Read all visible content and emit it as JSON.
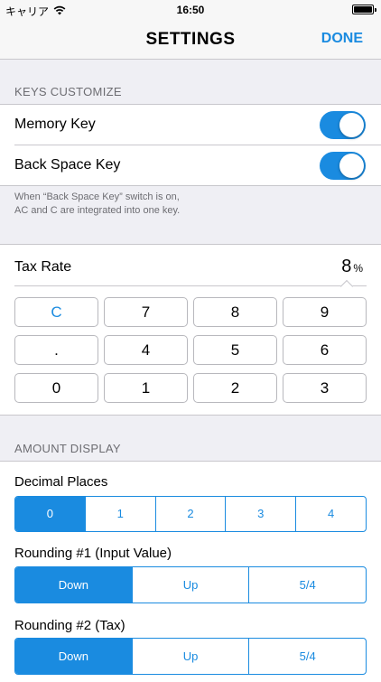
{
  "status_bar": {
    "carrier": "キャリア",
    "time": "16:50"
  },
  "nav": {
    "title": "SETTINGS",
    "done_label": "DONE"
  },
  "keys_customize": {
    "header": "KEYS CUSTOMIZE",
    "memory_key": {
      "label": "Memory Key",
      "on": true
    },
    "back_space_key": {
      "label": "Back Space Key",
      "on": true
    },
    "footnote_line1": "When “Back Space Key” switch is on,",
    "footnote_line2": "AC and C are integrated into one key."
  },
  "tax": {
    "label": "Tax Rate",
    "value": "8",
    "unit": "%",
    "keys": [
      [
        "C",
        "7",
        "8",
        "9"
      ],
      [
        ".",
        "4",
        "5",
        "6"
      ],
      [
        "0",
        "1",
        "2",
        "3"
      ]
    ]
  },
  "amount_display": {
    "header": "AMOUNT DISPLAY",
    "decimal_places": {
      "label": "Decimal Places",
      "options": [
        "0",
        "1",
        "2",
        "3",
        "4"
      ],
      "selected": 0
    },
    "rounding1": {
      "label": "Rounding #1 (Input Value)",
      "options": [
        "Down",
        "Up",
        "5/4"
      ],
      "selected": 0
    },
    "rounding2": {
      "label": "Rounding #2 (Tax)",
      "options": [
        "Down",
        "Up",
        "5/4"
      ],
      "selected": 0
    }
  },
  "colors": {
    "accent": "#1a8be0",
    "background": "#efeff4",
    "separator": "#c8c7cc"
  }
}
